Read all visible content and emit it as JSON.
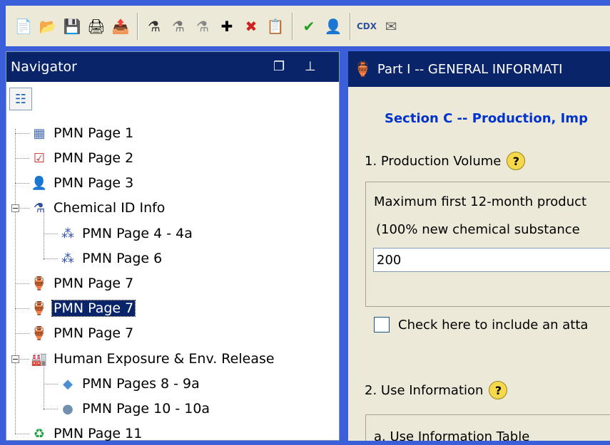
{
  "toolbar": {
    "buttons": [
      {
        "name": "new-icon",
        "glyph": "📄"
      },
      {
        "name": "open-folder-icon",
        "glyph": "📂"
      },
      {
        "name": "save-icon",
        "glyph": "💾"
      },
      {
        "name": "print-icon",
        "glyph": "🖨"
      },
      {
        "name": "export-icon",
        "glyph": "📤"
      }
    ],
    "group2": [
      {
        "name": "chemical-add-icon",
        "glyph": "⚗"
      },
      {
        "name": "chemical-icon",
        "glyph": "⚗"
      },
      {
        "name": "chemical-multi-icon",
        "glyph": "⚗"
      },
      {
        "name": "plus-icon",
        "glyph": "✚"
      },
      {
        "name": "delete-x-icon",
        "glyph": "✖"
      },
      {
        "name": "copy-icon",
        "glyph": "📋"
      }
    ],
    "group3": [
      {
        "name": "check-icon",
        "glyph": "✔"
      },
      {
        "name": "user-icon",
        "glyph": "👤"
      }
    ],
    "cdx_label": "CDX",
    "mail_glyph": "✉"
  },
  "navigator": {
    "title": "Navigator",
    "restore_glyph": "❐",
    "pin_glyph": "⊥",
    "root_glyph": "☷",
    "items": [
      {
        "label": "PMN Page 1",
        "glyph": "▦",
        "color": "#4a6fb0"
      },
      {
        "label": "PMN Page 2",
        "glyph": "☑",
        "color": "#c03030"
      },
      {
        "label": "PMN Page 3",
        "glyph": "👤",
        "color": "#e0a020"
      },
      {
        "label": "Chemical ID Info",
        "glyph": "⚗",
        "color": "#3050a0"
      },
      {
        "label": "PMN Page 4 - 4a",
        "glyph": "⁂",
        "color": "#3050b0"
      },
      {
        "label": "PMN Page 6",
        "glyph": "⁂",
        "color": "#3050b0"
      },
      {
        "label": "PMN Page 7",
        "glyph": "🏺",
        "color": "#a07030"
      },
      {
        "label": "PMN Page 7",
        "glyph": "🏺",
        "color": "#a07030"
      },
      {
        "label": "PMN Page 7",
        "glyph": "🏺",
        "color": "#a07030"
      },
      {
        "label": "Human Exposure & Env. Release",
        "glyph": "🏭",
        "color": "#406080"
      },
      {
        "label": "PMN Pages 8 - 9a",
        "glyph": "◆",
        "color": "#4a90d0"
      },
      {
        "label": "PMN Page 10 - 10a",
        "glyph": "●",
        "color": "#7090b0"
      },
      {
        "label": "PMN Page 11",
        "glyph": "♻",
        "color": "#20a040"
      }
    ]
  },
  "part": {
    "title": "Part I -- GENERAL INFORMATI",
    "section": "Section C -- Production, Imp",
    "q1": "1. Production Volume",
    "max_text": "Maximum first 12-month product",
    "new_text": "(100% new chemical substance",
    "volume_value": "200",
    "checkbox_text": "Check here to include an atta",
    "q2": "2. Use Information",
    "use_table": "a. Use Information Table",
    "help_glyph": "?"
  }
}
